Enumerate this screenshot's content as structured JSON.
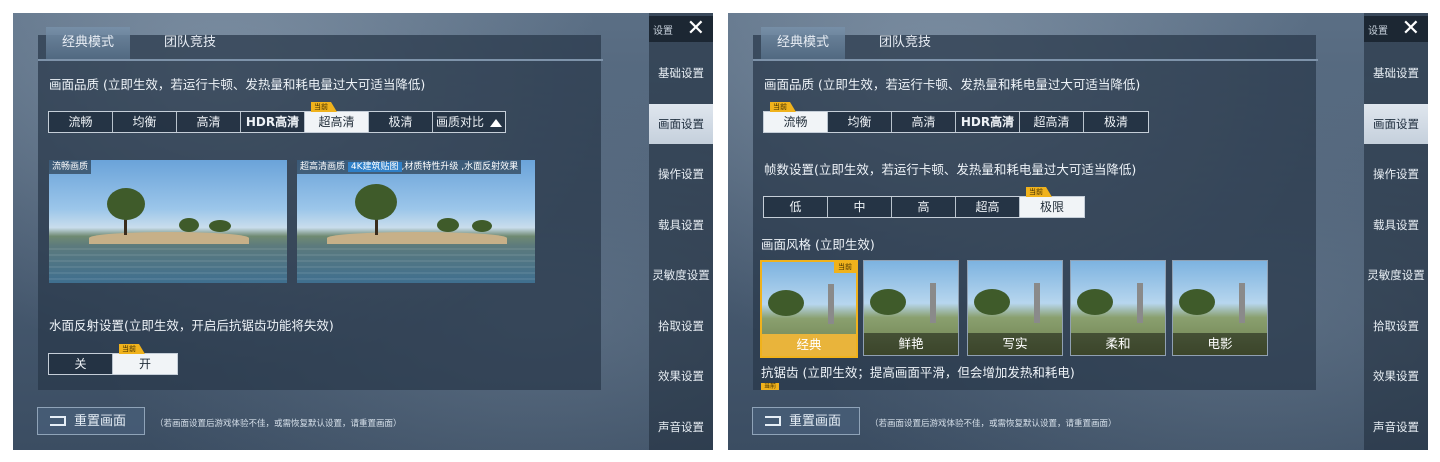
{
  "common": {
    "close_label": "设置",
    "sidebar": [
      "基础设置",
      "画面设置",
      "操作设置",
      "载具设置",
      "灵敏度设置",
      "拾取设置",
      "效果设置",
      "声音设置"
    ],
    "tabs": [
      "经典模式",
      "团队竞技"
    ],
    "reset_label": "重置画面",
    "reset_note": "（若画面设置后游戏体验不佳，或需恢复默认设置，请重置画面）",
    "current_badge": "当前"
  },
  "left": {
    "quality_title": "画面品质 (立即生效，若运行卡顿、发热量和耗电量过大可适当降低)",
    "quality_options": [
      "流畅",
      "均衡",
      "高清",
      "HDR高清",
      "超高清",
      "极清",
      "画质对比"
    ],
    "preview_left_caption": "流畅画质",
    "preview_right_caption": "超高清画质",
    "preview_right_highlight": "4K建筑贴图",
    "preview_right_extra": ",材质特性升级 ,水面反射效果",
    "water_title": "水面反射设置(立即生效，开启后抗锯齿功能将失效)",
    "water_options": [
      "关",
      "开"
    ]
  },
  "right": {
    "quality_title": "画面品质 (立即生效，若运行卡顿、发热量和耗电量过大可适当降低)",
    "quality_options": [
      "流畅",
      "均衡",
      "高清",
      "HDR高清",
      "超高清",
      "极清"
    ],
    "fps_title": "帧数设置(立即生效，若运行卡顿、发热量和耗电量过大可适当降低)",
    "fps_options": [
      "低",
      "中",
      "高",
      "超高",
      "极限"
    ],
    "style_title": "画面风格 (立即生效)",
    "styles": [
      "经典",
      "鲜艳",
      "写实",
      "柔和",
      "电影"
    ],
    "aa_title": "抗锯齿 (立即生效；提高画面平滑，但会增加发热和耗电)"
  },
  "colors": {
    "badge": "#f0b21c",
    "selected_bg": "#f1f4f7",
    "panel": "#28384a"
  }
}
